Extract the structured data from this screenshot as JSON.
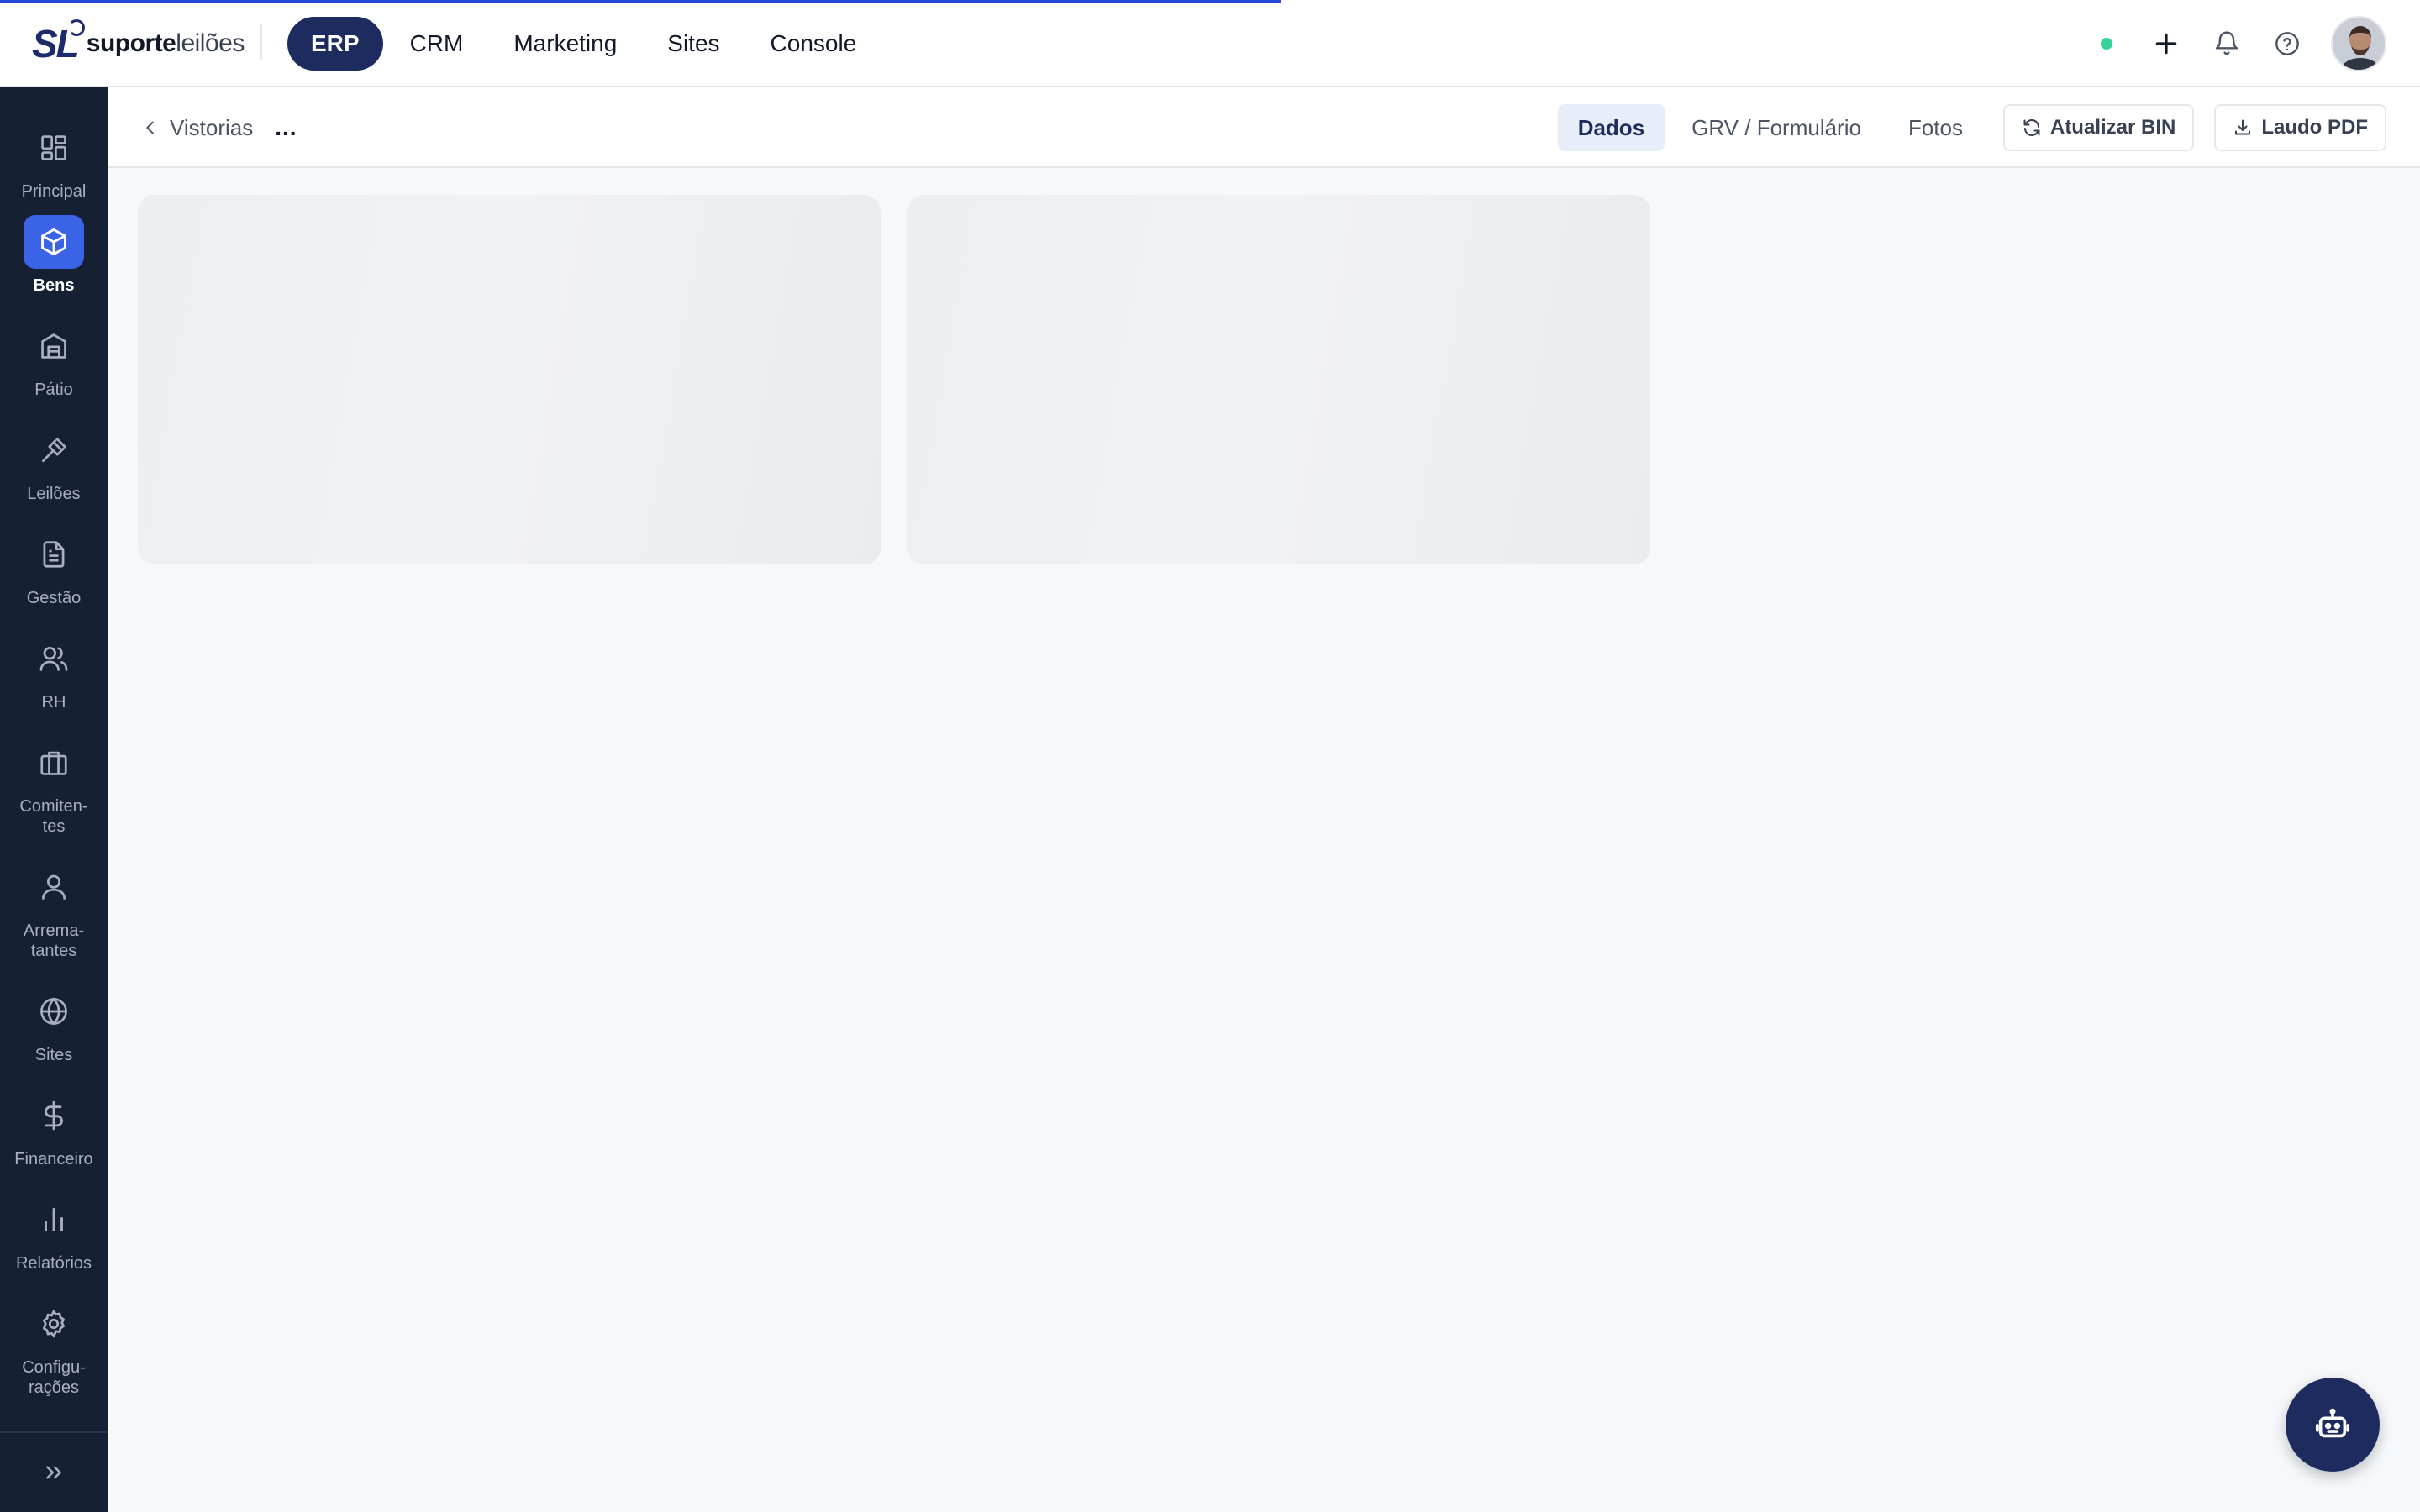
{
  "brand": {
    "mark": "SL",
    "name_bold": "suporte",
    "name_light": "leilões"
  },
  "topnav": [
    {
      "label": "ERP",
      "active": true
    },
    {
      "label": "CRM",
      "active": false
    },
    {
      "label": "Marketing",
      "active": false
    },
    {
      "label": "Sites",
      "active": false
    },
    {
      "label": "Console",
      "active": false
    }
  ],
  "topright": {
    "status": "online",
    "icons": [
      "plus-icon",
      "bell-icon",
      "help-icon"
    ]
  },
  "sidebar": {
    "items": [
      {
        "label": "Principal",
        "icon": "grid-icon"
      },
      {
        "label": "Bens",
        "icon": "box-icon",
        "active": true
      },
      {
        "label": "Pátio",
        "icon": "building-icon"
      },
      {
        "label": "Leilões",
        "icon": "gavel-icon"
      },
      {
        "label": "Gestão",
        "icon": "document-icon"
      },
      {
        "label": "RH",
        "icon": "users-icon"
      },
      {
        "label": "Comiten-\ntes",
        "icon": "briefcase-icon"
      },
      {
        "label": "Arrema-\ntantes",
        "icon": "user-icon"
      },
      {
        "label": "Sites",
        "icon": "globe-icon"
      },
      {
        "label": "Financeiro",
        "icon": "dollar-icon"
      },
      {
        "label": "Relatórios",
        "icon": "bar-chart-icon"
      },
      {
        "label": "Configu-\nrações",
        "icon": "gear-icon"
      }
    ],
    "expand_icon": "chevrons-right-icon"
  },
  "subheader": {
    "breadcrumb_back": "Vistorias",
    "breadcrumb_more": "...",
    "tabs": [
      {
        "label": "Dados",
        "active": true
      },
      {
        "label": "GRV / Formulário",
        "active": false
      },
      {
        "label": "Fotos",
        "active": false
      }
    ],
    "update_bin_label": "Atualizar BIN",
    "pdf_label": "Laudo PDF"
  },
  "colors": {
    "accent": "#2449d8",
    "nav_active": "#1d2b5e",
    "sidebar_bg": "#162033",
    "sidebar_active": "#3b63e6",
    "status_online": "#34d399"
  }
}
